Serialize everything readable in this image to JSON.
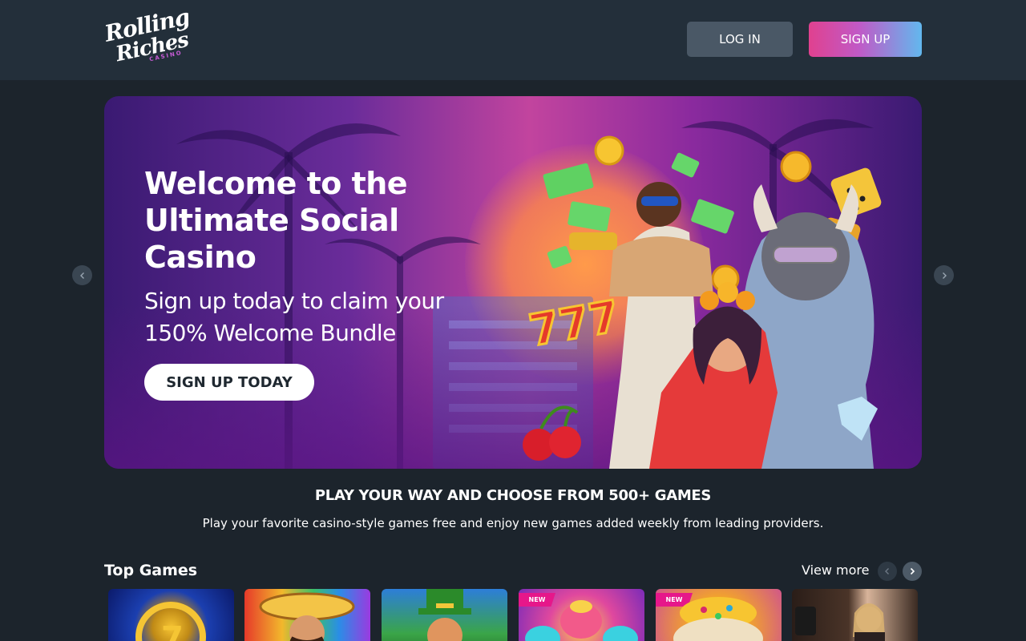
{
  "header": {
    "logo": {
      "line1": "Rolling",
      "line2": "Riches",
      "sub": "CASINO"
    },
    "login_label": "LOG IN",
    "signup_label": "SIGN UP"
  },
  "hero": {
    "title": "Welcome to the Ultimate Social Casino",
    "subtitle": "Sign up today to claim your 150% Welcome Bundle",
    "cta_label": "SIGN UP TODAY"
  },
  "carousel": {
    "prev_icon": "chevron-left-icon",
    "next_icon": "chevron-right-icon"
  },
  "promo": {
    "title": "PLAY YOUR WAY AND CHOOSE FROM 500+ GAMES",
    "subtitle": "Play your favorite casino-style games free and enjoy new games added weekly from leading providers."
  },
  "top_games": {
    "title": "Top Games",
    "view_more_label": "View more",
    "tiles": [
      {
        "badge": ""
      },
      {
        "badge": ""
      },
      {
        "badge": ""
      },
      {
        "badge": "NEW"
      },
      {
        "badge": "NEW"
      },
      {
        "badge": ""
      }
    ]
  },
  "colors": {
    "header_bg": "#232f3a",
    "page_bg": "#1c242c",
    "signup_gradient_start": "#e0418f",
    "signup_gradient_end": "#62b8ee",
    "login_bg": "#4a5866"
  }
}
